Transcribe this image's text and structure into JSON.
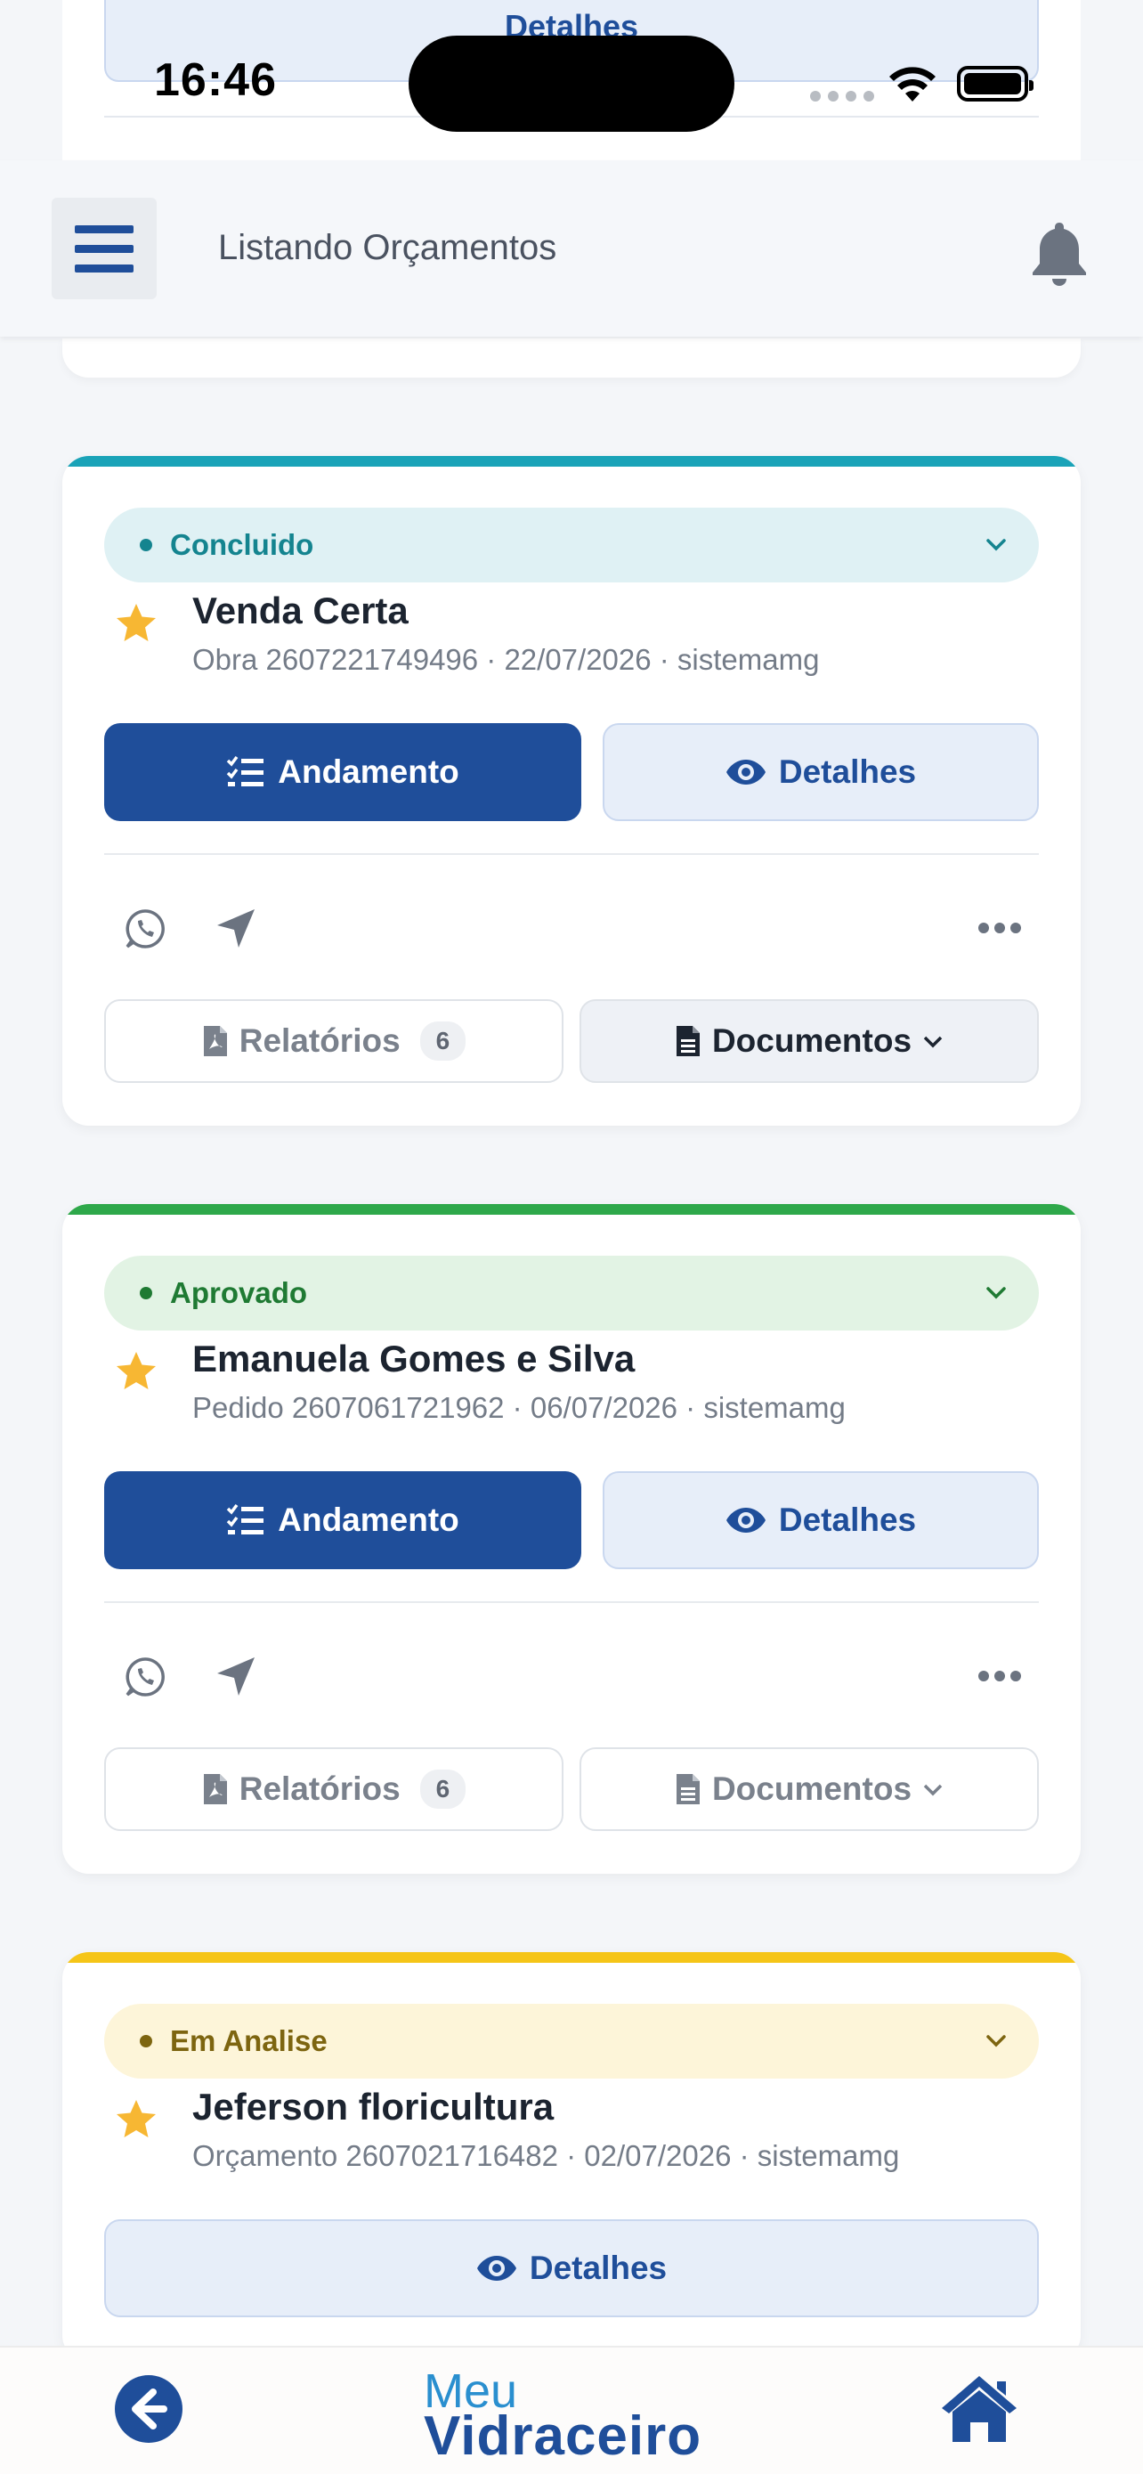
{
  "status_bar": {
    "time": "16:46"
  },
  "header": {
    "title": "Listando Orçamentos"
  },
  "top_card": {
    "details_label": "Detalhes"
  },
  "cards": [
    {
      "status": "Concluido",
      "client": "Venda Certa",
      "meta": "Obra 2607221749496 · 22/07/2026 · sistemamg",
      "progress_label": "Andamento",
      "details_label": "Detalhes",
      "reports_label": "Relatórios",
      "reports_count": "6",
      "documents_label": "Documentos"
    },
    {
      "status": "Aprovado",
      "client": "Emanuela Gomes e Silva",
      "meta": "Pedido 2607061721962 · 06/07/2026 · sistemamg",
      "progress_label": "Andamento",
      "details_label": "Detalhes",
      "reports_label": "Relatórios",
      "reports_count": "6",
      "documents_label": "Documentos"
    },
    {
      "status": "Em Analise",
      "client": "Jeferson floricultura",
      "meta": "Orçamento 2607021716482 · 02/07/2026 · sistemamg",
      "details_label": "Detalhes"
    }
  ],
  "bottom_bar": {
    "logo_line1": "Meu",
    "logo_line2": "Vidraceiro"
  },
  "colors": {
    "brand_blue": "#1f4e9a",
    "concluido": "#1aa3b8",
    "aprovado": "#2ea84a",
    "em_analise": "#f5c518",
    "star": "#f7b733"
  }
}
